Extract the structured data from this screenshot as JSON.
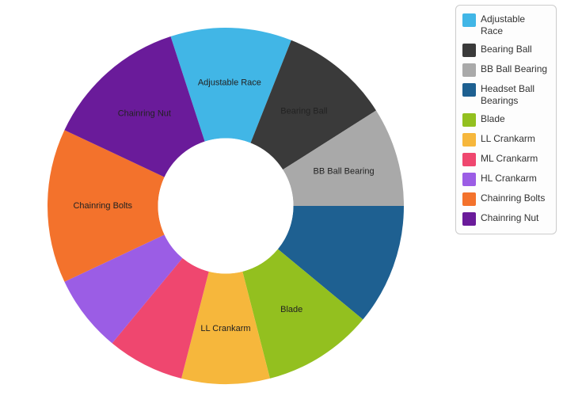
{
  "chart_data": {
    "type": "pie",
    "inner_radius_ratio": 0.38,
    "series": [
      {
        "name": "Adjustable Race",
        "value": 11,
        "color": "#41b6e6",
        "show_label": true
      },
      {
        "name": "Bearing Ball",
        "value": 10,
        "color": "#3a3a3a",
        "show_label": true
      },
      {
        "name": "BB Ball Bearing",
        "value": 9,
        "color": "#a9a9a9",
        "show_label": true
      },
      {
        "name": "Headset Ball Bearings",
        "value": 11,
        "color": "#1e6091",
        "show_label": false
      },
      {
        "name": "Blade",
        "value": 10,
        "color": "#93c01f",
        "show_label": true
      },
      {
        "name": "LL Crankarm",
        "value": 8,
        "color": "#f6b73c",
        "show_label": true
      },
      {
        "name": "ML Crankarm",
        "value": 7,
        "color": "#ef476f",
        "show_label": false
      },
      {
        "name": "HL Crankarm",
        "value": 7,
        "color": "#9b5de5",
        "show_label": false
      },
      {
        "name": "Chainring Bolts",
        "value": 14,
        "color": "#f3722c",
        "show_label": true
      },
      {
        "name": "Chainring Nut",
        "value": 13,
        "color": "#6a1b9a",
        "show_label": true
      }
    ]
  },
  "legend": {
    "items": [
      {
        "label": "Adjustable Race",
        "color": "#41b6e6"
      },
      {
        "label": "Bearing Ball",
        "color": "#3a3a3a"
      },
      {
        "label": "BB Ball Bearing",
        "color": "#a9a9a9"
      },
      {
        "label": "Headset Ball Bearings",
        "color": "#1e6091"
      },
      {
        "label": "Blade",
        "color": "#93c01f"
      },
      {
        "label": "LL Crankarm",
        "color": "#f6b73c"
      },
      {
        "label": "ML Crankarm",
        "color": "#ef476f"
      },
      {
        "label": "HL Crankarm",
        "color": "#9b5de5"
      },
      {
        "label": "Chainring Bolts",
        "color": "#f3722c"
      },
      {
        "label": "Chainring Nut",
        "color": "#6a1b9a"
      }
    ]
  }
}
